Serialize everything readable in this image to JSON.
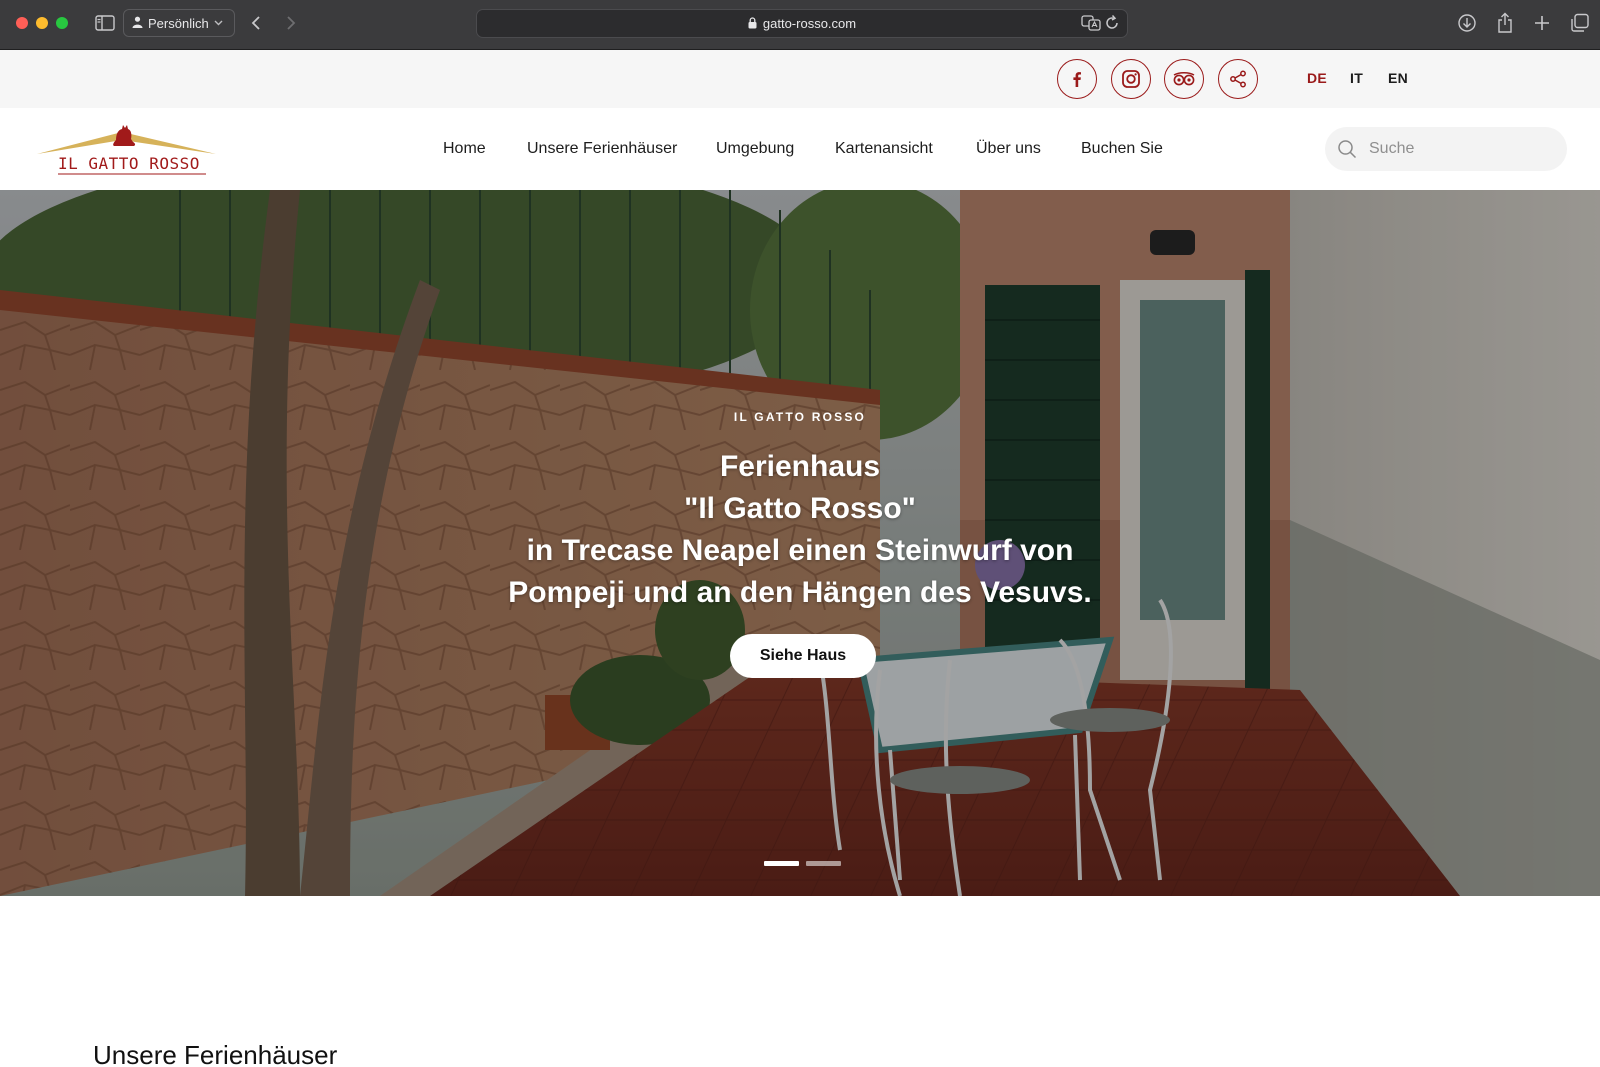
{
  "browser": {
    "profile_label": "Persönlich",
    "url": "gatto-rosso.com",
    "icons": [
      "sidebar-icon",
      "person-icon",
      "chevron-down-icon",
      "back-arrow-icon",
      "forward-arrow-icon",
      "lock-icon",
      "translate-icon",
      "reload-icon",
      "download-icon",
      "share-icon",
      "new-tab-icon",
      "tab-overview-icon"
    ]
  },
  "topbar": {
    "socials": [
      "facebook-icon",
      "instagram-icon",
      "tripadvisor-icon",
      "share-icon"
    ],
    "languages": [
      {
        "code": "DE",
        "active": true
      },
      {
        "code": "IT",
        "active": false
      },
      {
        "code": "EN",
        "active": false
      }
    ]
  },
  "header": {
    "logo_text": "IL GATTO ROSSO",
    "nav": [
      {
        "label": "Home"
      },
      {
        "label": "Unsere Ferienhäuser"
      },
      {
        "label": "Umgebung"
      },
      {
        "label": "Kartenansicht"
      },
      {
        "label": "Über uns"
      },
      {
        "label": "Buchen Sie"
      }
    ],
    "search_placeholder": "Suche"
  },
  "hero": {
    "eyebrow": "IL GATTO ROSSO",
    "headline_lines": [
      "Ferienhaus",
      "\"Il Gatto Rosso\"",
      "in Trecase Neapel einen Steinwurf von",
      "Pompeji und an den Hängen des Vesuvs."
    ],
    "cta_label": "Siehe Haus",
    "slides_total": 2,
    "slide_active": 1
  },
  "section": {
    "title": "Unsere Ferienhäuser"
  },
  "colors": {
    "brand_red": "#9a1a1a",
    "logo_gold": "#d6b25a",
    "chrome_bg": "#3b3b3d",
    "topbar_bg": "#f6f6f6"
  }
}
